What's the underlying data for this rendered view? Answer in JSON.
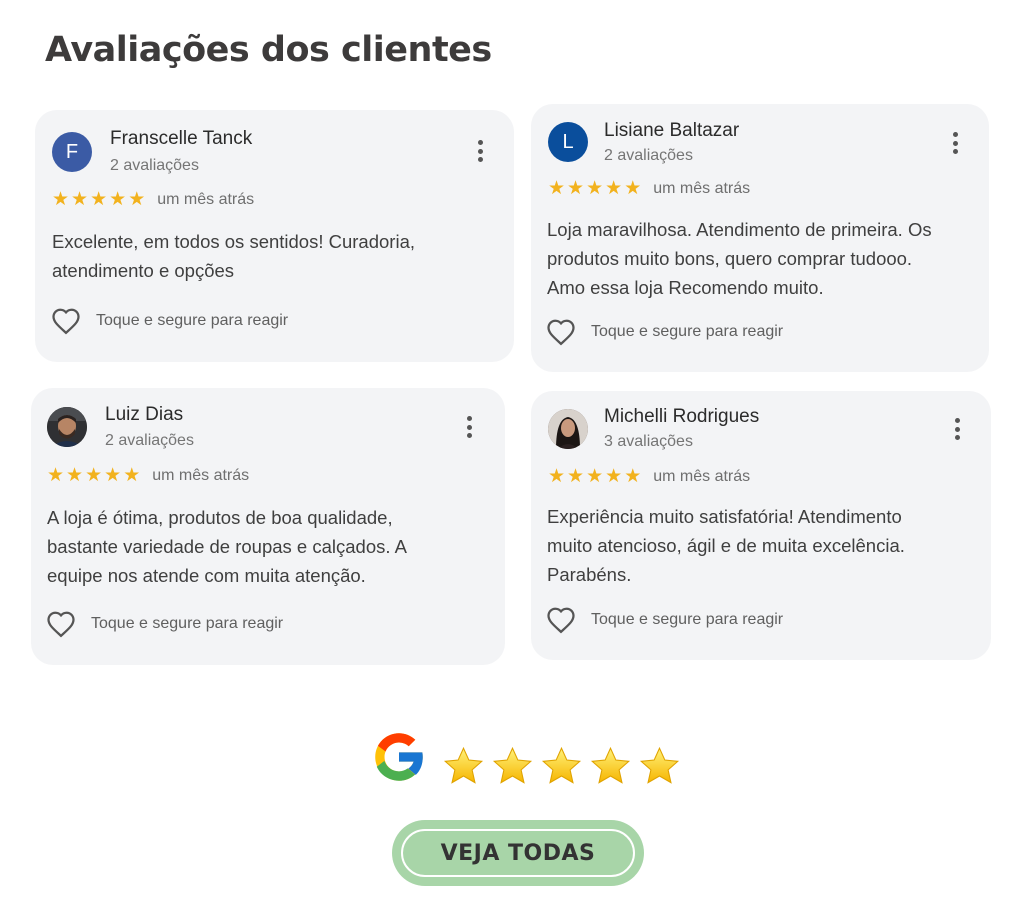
{
  "header": {
    "title": "Avaliações dos clientes"
  },
  "reviews": [
    {
      "initial": "F",
      "avatar_color": "#3b5ba5",
      "name": "Franscelle Tanck",
      "count": "2 avaliações",
      "stars": 5,
      "when": "um mês atrás",
      "lines": [
        "Excelente, em todos os sentidos! Curadoria,",
        "atendimento e opções"
      ],
      "react": "Toque e segure para reagir"
    },
    {
      "initial": "L",
      "avatar_color": "#0a4e9c",
      "name": "Lisiane Baltazar",
      "count": "2 avaliações",
      "stars": 5,
      "when": "um mês atrás",
      "lines": [
        "Loja maravilhosa. Atendimento de primeira. Os",
        "produtos muito bons, quero comprar tudooo.",
        "Amo essa loja Recomendo muito."
      ],
      "react": "Toque e segure para reagir"
    },
    {
      "initial": "",
      "avatar_color": "#3a3a3a",
      "name": "Luiz Dias",
      "count": "2 avaliações",
      "stars": 5,
      "when": "um mês atrás",
      "lines": [
        "A loja é ótima, produtos de boa qualidade,",
        "bastante variedade de roupas e calçados. A",
        "equipe nos atende com muita atenção."
      ],
      "react": "Toque e segure para reagir"
    },
    {
      "initial": "",
      "avatar_color": "#5a4a44",
      "name": "Michelli Rodrigues",
      "count": "3 avaliações",
      "stars": 5,
      "when": "um mês atrás",
      "lines": [
        "Experiência muito satisfatória! Atendimento",
        "muito atencioso, ágil e de muita excelência.",
        "Parabéns."
      ],
      "react": "Toque e segure para reagir"
    }
  ],
  "summary": {
    "stars": 5,
    "star_color": "#ffd21a"
  },
  "cta": {
    "label": "VEJA TODAS"
  },
  "colors": {
    "card_bg": "#f3f4f6",
    "star": "#f2b21e",
    "cta_bg": "#a8d5a8"
  }
}
